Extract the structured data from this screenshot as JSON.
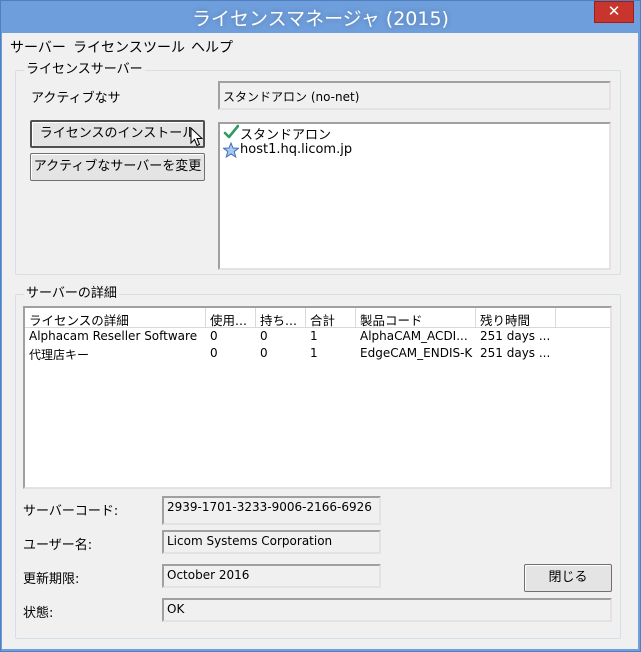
{
  "window": {
    "title": "ライセンスマネージャ (2015)",
    "close_glyph": "✕"
  },
  "menu": [
    "サーバー",
    "ライセンス",
    "ツール",
    "ヘルプ"
  ],
  "license_server": {
    "group_label": "ライセンスサーバー",
    "active_label": "アクティブなサ",
    "active_value": "スタンドアロン (no-net)",
    "install_button": "ライセンスのインストール",
    "change_button": "アクティブなサーバーを変更",
    "servers": [
      {
        "name": "スタンドアロン",
        "icon": "checkmark-icon"
      },
      {
        "name": "host1.hq.licom.jp",
        "icon": "star-icon"
      }
    ]
  },
  "server_details": {
    "group_label": "サーバーの詳細",
    "columns": [
      "ライセンスの詳細",
      "使用...",
      "持ち...",
      "合計",
      "製品コード",
      "残り時間"
    ],
    "rows": [
      [
        "Alphacam Reseller Software",
        "0",
        "0",
        "1",
        "AlphaCAM_ACDI...",
        "251 days ..."
      ],
      [
        "代理店キー",
        "0",
        "0",
        "1",
        "EdgeCAM_ENDIS-K",
        "251 days ..."
      ]
    ],
    "server_code_label": "サーバーコード:",
    "server_code": "2939-1701-3233-9006-2166-6926",
    "user_label": "ユーザー名:",
    "user_name": "Licom Systems Corporation",
    "expiry_label": "更新期限:",
    "expiry": "October 2016",
    "status_label": "状態:",
    "status": "OK",
    "close_button": "閉じる"
  },
  "colors": {
    "title_bar": "#6e9edc",
    "close_button": "#c7352c",
    "checkmark": "#2f9a62",
    "star": "#5b8fd6"
  }
}
